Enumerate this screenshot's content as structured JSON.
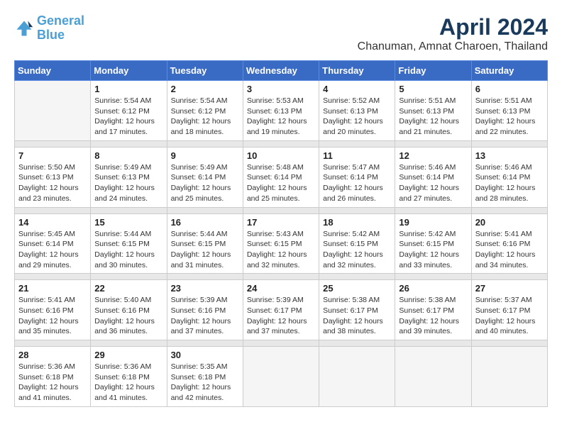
{
  "logo": {
    "line1": "General",
    "line2": "Blue"
  },
  "title": "April 2024",
  "subtitle": "Chanuman, Amnat Charoen, Thailand",
  "days_header": [
    "Sunday",
    "Monday",
    "Tuesday",
    "Wednesday",
    "Thursday",
    "Friday",
    "Saturday"
  ],
  "weeks": [
    [
      {
        "day": "",
        "info": ""
      },
      {
        "day": "1",
        "info": "Sunrise: 5:54 AM\nSunset: 6:12 PM\nDaylight: 12 hours\nand 17 minutes."
      },
      {
        "day": "2",
        "info": "Sunrise: 5:54 AM\nSunset: 6:12 PM\nDaylight: 12 hours\nand 18 minutes."
      },
      {
        "day": "3",
        "info": "Sunrise: 5:53 AM\nSunset: 6:13 PM\nDaylight: 12 hours\nand 19 minutes."
      },
      {
        "day": "4",
        "info": "Sunrise: 5:52 AM\nSunset: 6:13 PM\nDaylight: 12 hours\nand 20 minutes."
      },
      {
        "day": "5",
        "info": "Sunrise: 5:51 AM\nSunset: 6:13 PM\nDaylight: 12 hours\nand 21 minutes."
      },
      {
        "day": "6",
        "info": "Sunrise: 5:51 AM\nSunset: 6:13 PM\nDaylight: 12 hours\nand 22 minutes."
      }
    ],
    [
      {
        "day": "7",
        "info": "Sunrise: 5:50 AM\nSunset: 6:13 PM\nDaylight: 12 hours\nand 23 minutes."
      },
      {
        "day": "8",
        "info": "Sunrise: 5:49 AM\nSunset: 6:13 PM\nDaylight: 12 hours\nand 24 minutes."
      },
      {
        "day": "9",
        "info": "Sunrise: 5:49 AM\nSunset: 6:14 PM\nDaylight: 12 hours\nand 25 minutes."
      },
      {
        "day": "10",
        "info": "Sunrise: 5:48 AM\nSunset: 6:14 PM\nDaylight: 12 hours\nand 25 minutes."
      },
      {
        "day": "11",
        "info": "Sunrise: 5:47 AM\nSunset: 6:14 PM\nDaylight: 12 hours\nand 26 minutes."
      },
      {
        "day": "12",
        "info": "Sunrise: 5:46 AM\nSunset: 6:14 PM\nDaylight: 12 hours\nand 27 minutes."
      },
      {
        "day": "13",
        "info": "Sunrise: 5:46 AM\nSunset: 6:14 PM\nDaylight: 12 hours\nand 28 minutes."
      }
    ],
    [
      {
        "day": "14",
        "info": "Sunrise: 5:45 AM\nSunset: 6:14 PM\nDaylight: 12 hours\nand 29 minutes."
      },
      {
        "day": "15",
        "info": "Sunrise: 5:44 AM\nSunset: 6:15 PM\nDaylight: 12 hours\nand 30 minutes."
      },
      {
        "day": "16",
        "info": "Sunrise: 5:44 AM\nSunset: 6:15 PM\nDaylight: 12 hours\nand 31 minutes."
      },
      {
        "day": "17",
        "info": "Sunrise: 5:43 AM\nSunset: 6:15 PM\nDaylight: 12 hours\nand 32 minutes."
      },
      {
        "day": "18",
        "info": "Sunrise: 5:42 AM\nSunset: 6:15 PM\nDaylight: 12 hours\nand 32 minutes."
      },
      {
        "day": "19",
        "info": "Sunrise: 5:42 AM\nSunset: 6:15 PM\nDaylight: 12 hours\nand 33 minutes."
      },
      {
        "day": "20",
        "info": "Sunrise: 5:41 AM\nSunset: 6:16 PM\nDaylight: 12 hours\nand 34 minutes."
      }
    ],
    [
      {
        "day": "21",
        "info": "Sunrise: 5:41 AM\nSunset: 6:16 PM\nDaylight: 12 hours\nand 35 minutes."
      },
      {
        "day": "22",
        "info": "Sunrise: 5:40 AM\nSunset: 6:16 PM\nDaylight: 12 hours\nand 36 minutes."
      },
      {
        "day": "23",
        "info": "Sunrise: 5:39 AM\nSunset: 6:16 PM\nDaylight: 12 hours\nand 37 minutes."
      },
      {
        "day": "24",
        "info": "Sunrise: 5:39 AM\nSunset: 6:17 PM\nDaylight: 12 hours\nand 37 minutes."
      },
      {
        "day": "25",
        "info": "Sunrise: 5:38 AM\nSunset: 6:17 PM\nDaylight: 12 hours\nand 38 minutes."
      },
      {
        "day": "26",
        "info": "Sunrise: 5:38 AM\nSunset: 6:17 PM\nDaylight: 12 hours\nand 39 minutes."
      },
      {
        "day": "27",
        "info": "Sunrise: 5:37 AM\nSunset: 6:17 PM\nDaylight: 12 hours\nand 40 minutes."
      }
    ],
    [
      {
        "day": "28",
        "info": "Sunrise: 5:36 AM\nSunset: 6:18 PM\nDaylight: 12 hours\nand 41 minutes."
      },
      {
        "day": "29",
        "info": "Sunrise: 5:36 AM\nSunset: 6:18 PM\nDaylight: 12 hours\nand 41 minutes."
      },
      {
        "day": "30",
        "info": "Sunrise: 5:35 AM\nSunset: 6:18 PM\nDaylight: 12 hours\nand 42 minutes."
      },
      {
        "day": "",
        "info": ""
      },
      {
        "day": "",
        "info": ""
      },
      {
        "day": "",
        "info": ""
      },
      {
        "day": "",
        "info": ""
      }
    ]
  ]
}
